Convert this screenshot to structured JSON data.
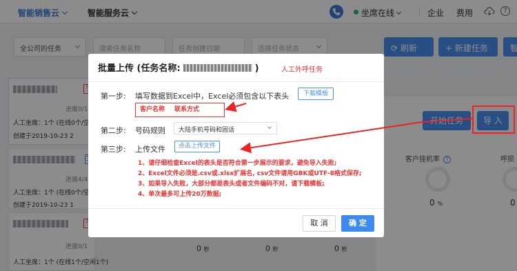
{
  "topbar": {
    "tab_sales": "智能销售云",
    "tab_service": "智能服务云",
    "agent_status": "坐席在线",
    "link_enterprise": "企业",
    "link_fees": "费用",
    "help_glyph": "?"
  },
  "filters": {
    "task_scope": "全公司的任务",
    "search_placeholder": "搜索任务名称",
    "created_date_placeholder": "任务创建日期",
    "status_placeholder": "选择任务状态",
    "refresh_label": "刷新",
    "new_task_label": "新建任务",
    "truncated_btn": "智"
  },
  "task_list": [
    {
      "tag": "手",
      "progress": "进度0/1",
      "agents": "人工坐席：1个 (在线0个/空",
      "created": "创建于2019-10-23 2"
    },
    {
      "tag": "文",
      "progress": "进度4/4",
      "agents": "人工坐席：1个 (在线0个/空",
      "created": "创建于2019-10-23 1"
    },
    {
      "tag": "手",
      "progress": "进度0/1",
      "agents": "人工坐席：1个 (在线1个/空闲1个)",
      "created": ""
    }
  ],
  "right_panel": {
    "start_task": "开始任务",
    "import": "导 入",
    "metric_hangup_label": "客户挂机率",
    "metric_hangup_value": "0",
    "metric_hangup_unit": "%",
    "metric_partial_label": "呼损",
    "metric_partial_value": "0",
    "truncated_metric_unit": "秒",
    "bottom_values": [
      "0",
      "0",
      "0"
    ],
    "bottom_unit": "秒"
  },
  "modal": {
    "title_prefix": "批量上传 (任务名称:",
    "title_suffix": ")",
    "annotation": "人工外呼任务",
    "step1_label": "第一步:",
    "step1_text": "填写数据到Excel中，Excel必须包含以下表头",
    "download_template": "下载模板",
    "header_customer_name": "客户名称",
    "header_contact": "联系方式",
    "step2_label": "第二步:",
    "step2_text": "号码规则",
    "number_rule": "大陆手机号码和固话",
    "step3_label": "第三步:",
    "step3_text": "上传文件",
    "upload_button": "点击上传文件",
    "notes": [
      "1、请仔细检查Excel的表头是否符合第一步展示的要求，避免导入失败;",
      "2、Excel文件必须是.csv或.xlsx扩展名, csv文件请用GBK或UTF-8格式保存;",
      "3、如果导入失败，大部分都是表头或者文件编码不对，请下载模板;",
      "4、单次最多可上传20万数据;"
    ],
    "cancel": "取 消",
    "confirm": "确 定"
  },
  "colors": {
    "primary": "#4a8ff0",
    "annotation_red": "#e33",
    "online_green": "#31b46f"
  }
}
